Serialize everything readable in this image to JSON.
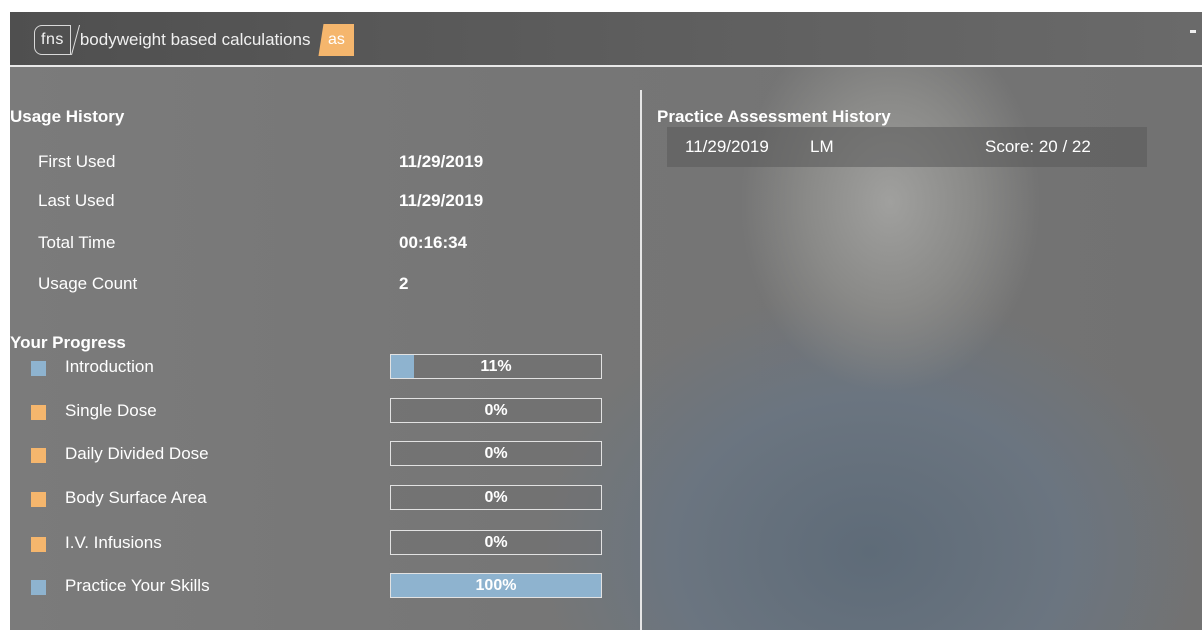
{
  "header": {
    "logo_prefix": "fns",
    "title": "bodyweight based calculations",
    "badge": "as",
    "minimize_icon": "minimize-icon"
  },
  "colors": {
    "accent_orange": "#f5b66d",
    "accent_blue": "#8eb3cf",
    "swatch_blue": "#8eb3cf",
    "swatch_orange": "#f5b66d"
  },
  "usage_history": {
    "heading": "Usage History",
    "rows": [
      {
        "label": "First Used",
        "value": "11/29/2019"
      },
      {
        "label": "Last Used",
        "value": "11/29/2019"
      },
      {
        "label": "Total Time",
        "value": "00:16:34"
      },
      {
        "label": "Usage Count",
        "value": "2"
      }
    ]
  },
  "progress": {
    "heading": "Your Progress",
    "items": [
      {
        "label": "Introduction",
        "percent_text": "11%",
        "percent": 11,
        "status": "started"
      },
      {
        "label": "Single Dose",
        "percent_text": "0%",
        "percent": 0,
        "status": "not-started"
      },
      {
        "label": "Daily Divided Dose",
        "percent_text": "0%",
        "percent": 0,
        "status": "not-started"
      },
      {
        "label": "Body Surface Area",
        "percent_text": "0%",
        "percent": 0,
        "status": "not-started"
      },
      {
        "label": "I.V. Infusions",
        "percent_text": "0%",
        "percent": 0,
        "status": "not-started"
      },
      {
        "label": "Practice Your Skills",
        "percent_text": "100%",
        "percent": 100,
        "status": "started"
      }
    ]
  },
  "assessment_history": {
    "heading": "Practice Assessment History",
    "rows": [
      {
        "date": "11/29/2019",
        "initials": "LM",
        "score": "Score: 20 / 22"
      }
    ]
  }
}
